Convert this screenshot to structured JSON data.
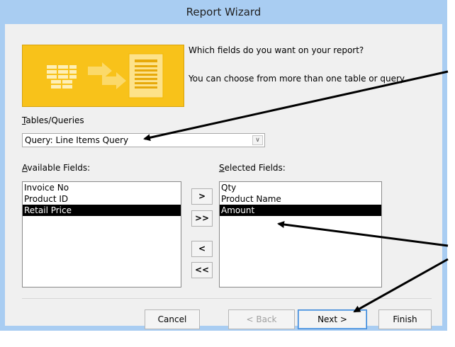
{
  "window": {
    "title": "Report Wizard"
  },
  "prompts": {
    "line1": "Which fields do you want on your report?",
    "line2": "You can choose from more than one table or query."
  },
  "tables_queries": {
    "label": "Tables/Queries",
    "value": "Query: Line Items Query"
  },
  "available_fields": {
    "label": "Available Fields:",
    "items": [
      "Invoice No",
      "Product ID",
      "Retail Price"
    ],
    "selected_index": 2
  },
  "selected_fields": {
    "label": "Selected Fields:",
    "items": [
      "Qty",
      "Product Name",
      "Amount"
    ],
    "selected_index": 2
  },
  "move_buttons": {
    "add_one": ">",
    "add_all": ">>",
    "remove_one": "<",
    "remove_all": "<<"
  },
  "footer_buttons": {
    "cancel": "Cancel",
    "back": "< Back",
    "next": "Next >",
    "finish": "Finish"
  },
  "colors": {
    "title_bar": "#a9cdf2",
    "client_bg": "#f0f0f0",
    "hero_bg": "#f8c21a",
    "selection": "#000000"
  },
  "icons": [
    "dropdown-chevron-icon",
    "report-wizard-graphic"
  ]
}
